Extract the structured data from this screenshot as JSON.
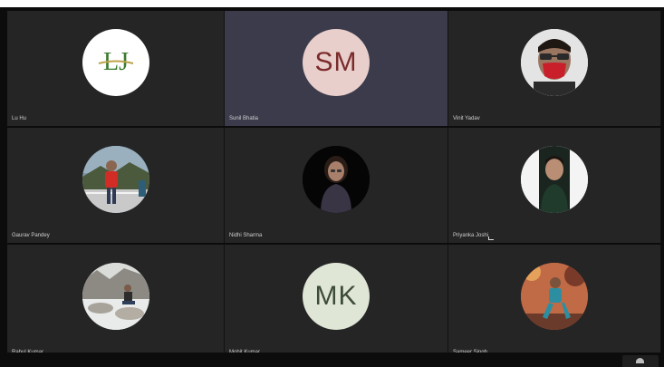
{
  "participants": [
    {
      "name": "Lu Hu",
      "avatar_type": "logo",
      "initials": "LJ",
      "avatar_bg": "#ffffff",
      "text_color": "#3a7a2e"
    },
    {
      "name": "Sunil Bhatia",
      "avatar_type": "initials",
      "initials": "SM",
      "avatar_bg": "#e9cfcc",
      "text_color": "#7a2b2b",
      "active": true
    },
    {
      "name": "Vinit Yadav",
      "avatar_type": "photo",
      "photo_hint": "man-with-red-mask"
    },
    {
      "name": "Gaurav Pandey",
      "avatar_type": "photo",
      "photo_hint": "man-red-jacket-outdoors"
    },
    {
      "name": "Nidhi Sharma",
      "avatar_type": "photo",
      "photo_hint": "woman-dark-background"
    },
    {
      "name": "Priyanka Joshi",
      "avatar_type": "photo",
      "photo_hint": "man-white-background"
    },
    {
      "name": "Rahul Kumar",
      "avatar_type": "photo",
      "photo_hint": "man-sitting-on-rocks"
    },
    {
      "name": "Mohit Kumar",
      "avatar_type": "initials",
      "initials": "MK",
      "avatar_bg": "#dfe6d6",
      "text_color": "#3f4b3a"
    },
    {
      "name": "Sameer Singh",
      "avatar_type": "photo",
      "photo_hint": "man-posing-outdoors"
    }
  ],
  "icons": {
    "self_view": "person-silhouette-icon"
  }
}
